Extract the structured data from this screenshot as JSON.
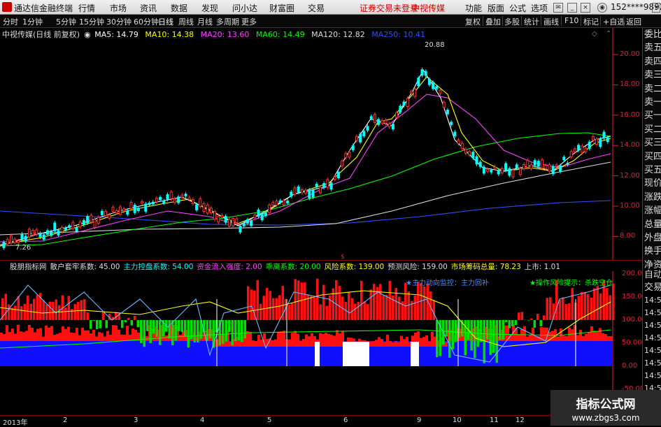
{
  "titlebar": {
    "app_title": "通达信金融终端",
    "menu": [
      "行情",
      "市场",
      "资讯",
      "数据",
      "发现",
      "问小达",
      "财富圈",
      "交易"
    ],
    "notice": "证券交易未登录",
    "stock_name_red": "中视传媒",
    "right_menu": [
      "功能",
      "版面",
      "公式",
      "选项"
    ],
    "phone": "152****9892",
    "colors": {
      "notice": "#d00000"
    }
  },
  "periodbar": {
    "periods": [
      "分时",
      "1分钟",
      "5分钟",
      "15分钟",
      "30分钟",
      "60分钟",
      "日线",
      "周线",
      "月线",
      "多周期",
      "更多"
    ],
    "active": "日线",
    "tools": [
      "复权",
      "叠加",
      "多股",
      "统计",
      "画线",
      "F10",
      "标记",
      "+自选",
      "返回"
    ]
  },
  "price_legend": {
    "title": "中视传媒(日线 前复权)",
    "ma": [
      {
        "label": "MA5: 14.79",
        "color": "#ffffff"
      },
      {
        "label": "MA10: 14.38",
        "color": "#ffff00"
      },
      {
        "label": "MA20: 13.60",
        "color": "#ff40ff"
      },
      {
        "label": "MA60: 14.49",
        "color": "#00ff00"
      },
      {
        "label": "MA120: 12.82",
        "color": "#dddddd"
      },
      {
        "label": "MA250: 10.41",
        "color": "#3050ff"
      }
    ]
  },
  "price_axis": [
    "20.00",
    "18.00",
    "16.00",
    "14.00",
    "12.00",
    "10.00",
    "8.00"
  ],
  "price_annotations": {
    "high": "20.88",
    "low": "7.26"
  },
  "side_panel": [
    "委比",
    "卖五",
    "卖四",
    "卖三",
    "卖二",
    "卖一",
    "买一",
    "买二",
    "买三",
    "买四",
    "买五",
    "现价",
    "涨跌",
    "涨幅",
    "总量",
    "外盘",
    "换手",
    "净资",
    "收益"
  ],
  "side_panel_lower": [
    "自动",
    "交易",
    "14:56",
    "14:56",
    "14:56",
    "14:56",
    "14:56",
    "14:56",
    "14:56",
    "14:56"
  ],
  "indicator_legend": [
    {
      "label": "股朋指标网",
      "color": "#dddddd"
    },
    {
      "label": "散户套牢系数: 45.00",
      "color": "#dddddd"
    },
    {
      "label": "主力控盘系数: 54.00",
      "color": "#00ffff"
    },
    {
      "label": "资金流入强度: 2.00",
      "color": "#ff40ff"
    },
    {
      "label": "乖离系数: 20.00",
      "color": "#00ff00"
    },
    {
      "label": "风险系数: 139.00",
      "color": "#ffff00"
    },
    {
      "label": "预测风险: 159.00",
      "color": "#dddddd"
    },
    {
      "label": "市场筹码总量: 78.23",
      "color": "#ffff00"
    },
    {
      "label": "上市: 1.01",
      "color": "#dddddd"
    }
  ],
  "indicator_annotations": {
    "monitor": "★主力动向监控：主力回补",
    "risk": "★操作风险提示：杀跌空仓"
  },
  "indicator_axis": [
    "200.0",
    "150.0",
    "100.0",
    "50.00",
    "0.00",
    "-50.00"
  ],
  "xaxis": [
    "2013年",
    "2",
    "3",
    "4",
    "5",
    "6",
    "9",
    "10",
    "11",
    "12",
    "1"
  ],
  "watermark": {
    "line1": "指标公式网",
    "line2": "www.zbgs3.com"
  }
}
